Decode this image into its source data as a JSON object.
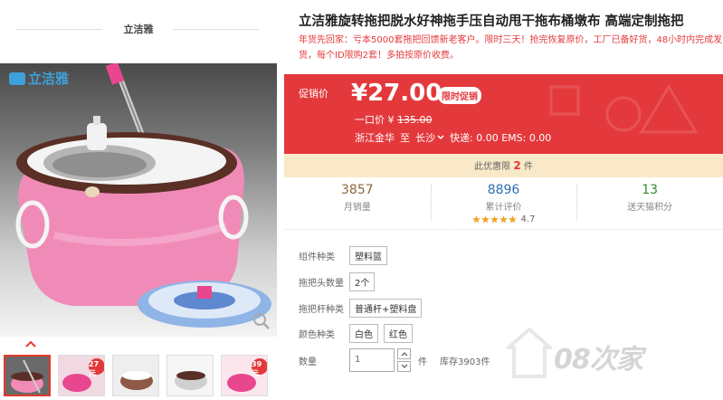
{
  "brand_header": {
    "title": "立洁雅"
  },
  "gallery": {
    "logo_text": "立洁雅",
    "thumbnails": [
      {
        "badge": ""
      },
      {
        "badge": "27元"
      },
      {
        "badge": ""
      },
      {
        "badge": ""
      },
      {
        "badge": "39元"
      }
    ]
  },
  "product": {
    "title": "立洁雅旋转拖把脱水好神拖手压自动甩干拖布桶墩布 高端定制拖把",
    "subtitle": "年货先回家：亏本5000套拖把回馈新老客户。限时三天！抢完恢复原价，工厂已备好货，48小时内完成发货，每个ID限购2套！多拍按原价收费。"
  },
  "price": {
    "promo_label": "促销价",
    "currency": "¥",
    "value": "27.00",
    "limit_tag": "限时促销",
    "orig_label": "一口价",
    "orig_currency": "¥",
    "orig_value": "135.00",
    "ship_from": "浙江金华",
    "ship_to_label": "至",
    "ship_to": "长沙",
    "ship_fees": "快递: 0.00 EMS: 0.00"
  },
  "tips": {
    "prefix": "此优惠限",
    "count": "2",
    "suffix": "件"
  },
  "stats": [
    {
      "value": "3857",
      "label": "月销量"
    },
    {
      "value": "8896",
      "label": "累计评价",
      "rating": "4.7"
    },
    {
      "value": "13",
      "label": "送天猫积分"
    }
  ],
  "options": {
    "component": {
      "label": "组件种类",
      "values": [
        "塑料篮"
      ]
    },
    "head_count": {
      "label": "拖把头数量",
      "values": [
        "2个"
      ]
    },
    "pole": {
      "label": "拖把杆种类",
      "values": [
        "普通杆+塑料盘"
      ]
    },
    "color": {
      "label": "颜色种类",
      "values": [
        "白色",
        "红色"
      ]
    }
  },
  "quantity": {
    "label": "数量",
    "value": "1",
    "unit": "件",
    "stock": "库存3903件"
  },
  "watermark": {
    "text": "08次家"
  },
  "colors": {
    "accent_red": "#e4393c",
    "tips_bg": "#f9e9c8",
    "stat_brown": "#8b6b3f",
    "stat_blue": "#2f6fb5",
    "stat_green": "#2e8b2e",
    "star": "#f0a020",
    "logo_blue": "#3fa1dc"
  }
}
